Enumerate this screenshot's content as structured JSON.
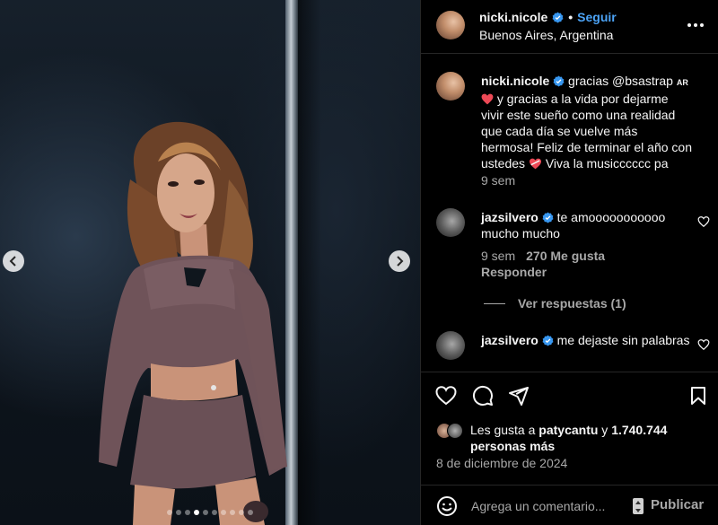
{
  "post": {
    "username": "nicki.nicole",
    "separator": "•",
    "follow_label": "Seguir",
    "location": "Buenos Aires, Argentina",
    "carousel": {
      "total": 10,
      "active": 3
    }
  },
  "caption": {
    "username": "nicki.nicole",
    "text_part1": "gracias @bsastrap",
    "tag": "AR",
    "text_part2": " y gracias a la vida por dejarme vivir este sueño como una realidad que cada día se vuelve más hermosa! Feliz de terminar el año con ustedes",
    "text_part3": "  Viva la musicccccc pa",
    "time": "9 sem"
  },
  "comments": [
    {
      "username": "jazsilvero",
      "text": "te amooooooooooo mucho mucho",
      "time": "9 sem",
      "likes": "270 Me gusta",
      "reply_label": "Responder",
      "view_replies": "Ver respuestas (1)"
    },
    {
      "username": "jazsilvero",
      "text": "me dejaste sin palabras"
    }
  ],
  "likes": {
    "prefix": "Les gusta a ",
    "user": "patycantu",
    "joiner": " y ",
    "count": "1.740.744 personas más"
  },
  "date": "8 de diciembre de 2024",
  "add_comment": {
    "placeholder": "Agrega un comentario...",
    "publish_label": "Publicar"
  },
  "colors": {
    "accent": "#4ca3f5",
    "verified": "#3897f0",
    "heart": "#ed4956"
  }
}
